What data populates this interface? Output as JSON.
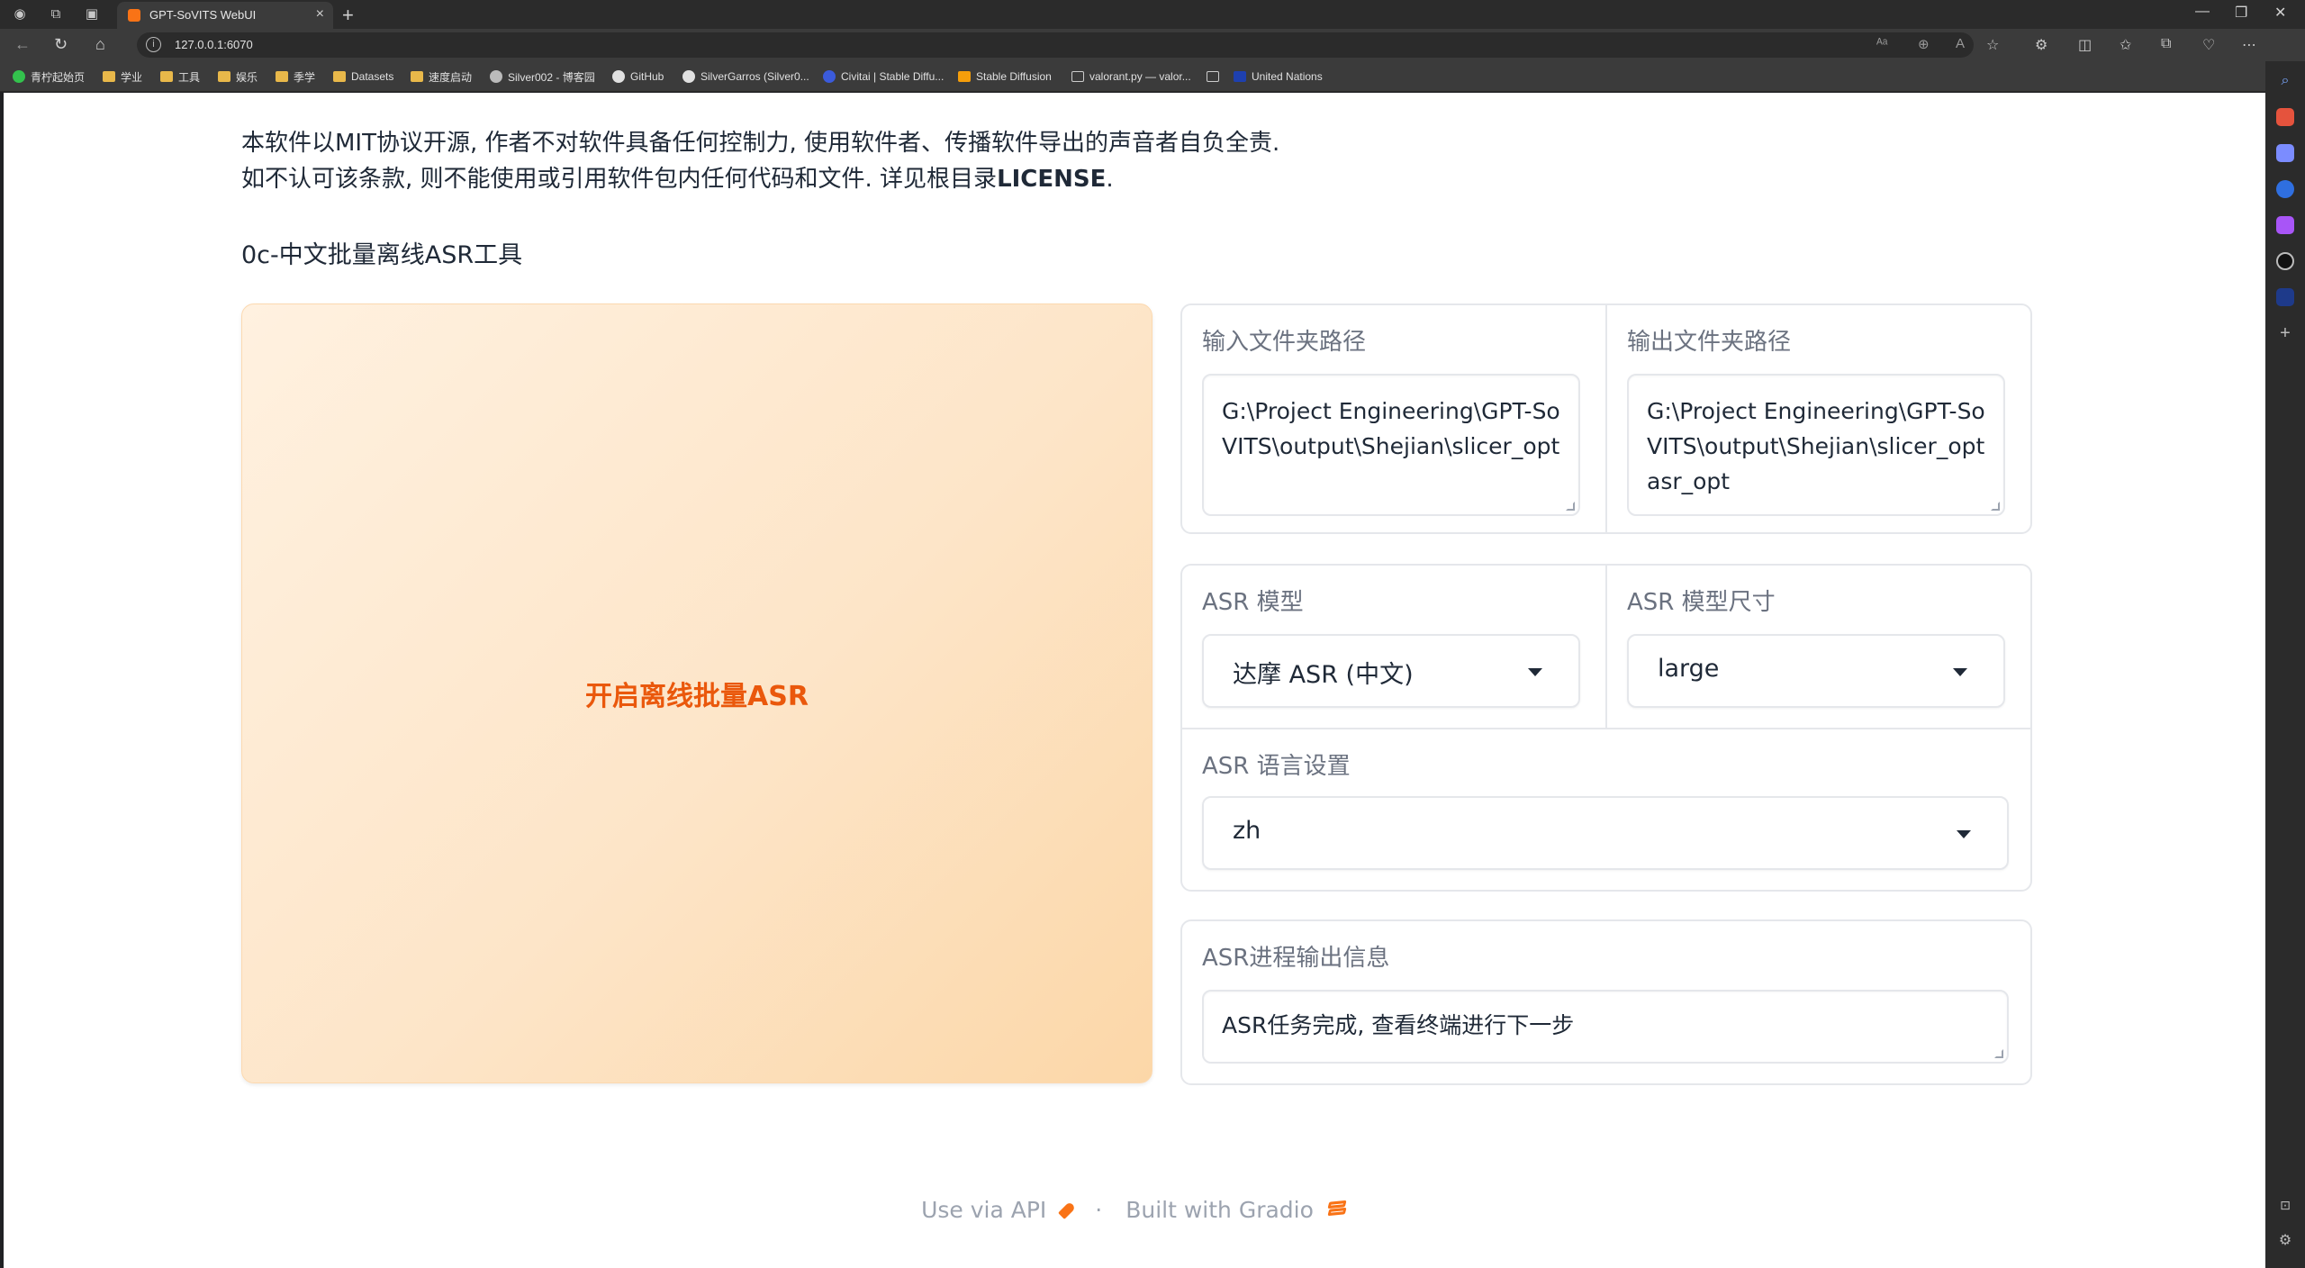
{
  "browser": {
    "tab_title": "GPT-SoVITS WebUI",
    "url": "127.0.0.1:6070",
    "bookmarks": [
      "青柠起始页",
      "学业",
      "工具",
      "娱乐",
      "季学",
      "Datasets",
      "速度启动",
      "Silver002 - 博客园",
      "GitHub",
      "SilverGarros (Silver0...",
      "Civitai | Stable Diffu...",
      "Stable Diffusion",
      "valorant.py — valor...",
      "United Nations"
    ]
  },
  "page": {
    "disclaimer_line1": "本软件以MIT协议开源, 作者不对软件具备任何控制力, 使用软件者、传播软件导出的声音者自负全责.",
    "disclaimer_line2a": "如不认可该条款, 则不能使用或引用软件包内任何代码和文件. 详见根目录",
    "disclaimer_line2b": "LICENSE",
    "disclaimer_line2c": ".",
    "section_title": "0c-中文批量离线ASR工具",
    "asr_button": "开启离线批量ASR",
    "input_dir_label": "输入文件夹路径",
    "input_dir_value": "G:\\Project Engineering\\GPT-SoVITS\\output\\Shejian\\slicer_opt",
    "output_dir_label": "输出文件夹路径",
    "output_dir_value": "G:\\Project Engineering\\GPT-SoVITS\\output\\Shejian\\slicer_optasr_opt",
    "asr_model_label": "ASR 模型",
    "asr_model_value": "达摩 ASR (中文)",
    "asr_size_label": "ASR 模型尺寸",
    "asr_size_value": "large",
    "asr_lang_label": "ASR 语言设置",
    "asr_lang_value": "zh",
    "asr_output_label": "ASR进程输出信息",
    "asr_output_value": "ASR任务完成, 查看终端进行下一步"
  },
  "footer": {
    "api": "Use via API",
    "sep": "·",
    "built": "Built with Gradio"
  },
  "colors": {
    "accent": "#ea580c",
    "button_bg": "#fde5c8"
  }
}
